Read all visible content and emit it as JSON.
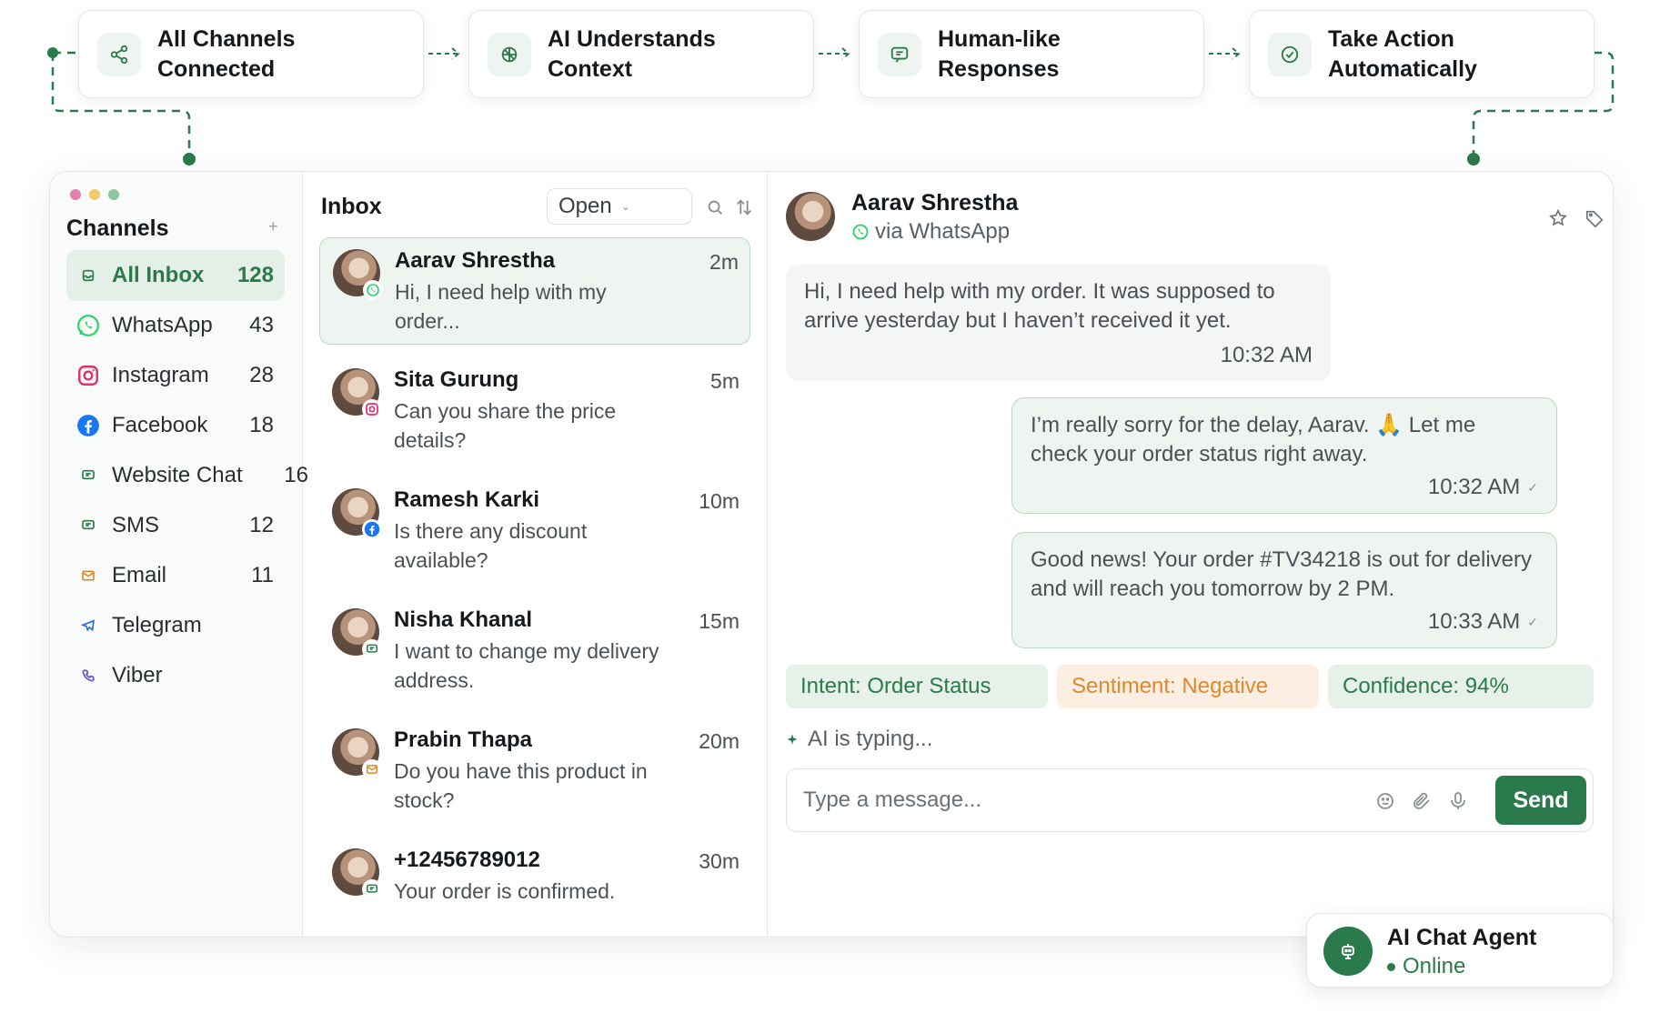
{
  "flow": {
    "steps": [
      {
        "label": "All Channels\nConnected",
        "icon": "share-icon"
      },
      {
        "label": "AI Understands\nContext",
        "icon": "brain-icon"
      },
      {
        "label": "Human-like\nResponses",
        "icon": "chat-bubble-icon"
      },
      {
        "label": "Take Action\nAutomatically",
        "icon": "check-circle-icon"
      }
    ]
  },
  "colors": {
    "brand": "#2b7a4b",
    "active_bg": "#e3efe7",
    "bubble_out": "#eef5f0",
    "sentiment_bg": "#fcefe2",
    "sentiment_text": "#e0892c",
    "window_dots": [
      "#e57fae",
      "#f0c76b",
      "#8cc79b"
    ]
  },
  "sidebar": {
    "title": "Channels",
    "add_label": "+",
    "items": [
      {
        "label": "All Inbox",
        "count": "128",
        "icon": "inbox-icon",
        "active": true
      },
      {
        "label": "WhatsApp",
        "count": "43",
        "icon": "whatsapp-icon"
      },
      {
        "label": "Instagram",
        "count": "28",
        "icon": "instagram-icon"
      },
      {
        "label": "Facebook",
        "count": "18",
        "icon": "facebook-icon"
      },
      {
        "label": "Website Chat",
        "count": "16",
        "icon": "website-chat-icon"
      },
      {
        "label": "SMS",
        "count": "12",
        "icon": "sms-icon"
      },
      {
        "label": "Email",
        "count": "11",
        "icon": "email-icon"
      },
      {
        "label": "Telegram",
        "count": "",
        "icon": "telegram-icon"
      },
      {
        "label": "Viber",
        "count": "",
        "icon": "viber-icon"
      }
    ]
  },
  "inbox": {
    "title": "Inbox",
    "filter": "Open",
    "conversations": [
      {
        "name": "Aarav Shrestha",
        "time": "2m",
        "message": "Hi, I need help with my order...",
        "channel": "whatsapp",
        "active": true
      },
      {
        "name": "Sita Gurung",
        "time": "5m",
        "message": "Can you share the price details?",
        "channel": "instagram"
      },
      {
        "name": "Ramesh Karki",
        "time": "10m",
        "message": "Is there any discount available?",
        "channel": "facebook"
      },
      {
        "name": "Nisha Khanal",
        "time": "15m",
        "message": "I want to change my delivery address.",
        "channel": "website-chat"
      },
      {
        "name": "Prabin Thapa",
        "time": "20m",
        "message": "Do you have this product in stock?",
        "channel": "email"
      },
      {
        "name": "+12456789012",
        "time": "30m",
        "message": "Your order is confirmed.",
        "channel": "sms"
      }
    ]
  },
  "chat": {
    "contact_name": "Aarav Shrestha",
    "via": "via WhatsApp",
    "messages": [
      {
        "direction": "in",
        "text": "Hi, I need help with my order. It was supposed to arrive yesterday but I haven’t received it yet.",
        "time": "10:32 AM"
      },
      {
        "direction": "out",
        "text": "I’m really sorry for the delay, Aarav. 🙏 Let me check your order status right away.",
        "time": "10:32 AM"
      },
      {
        "direction": "out",
        "text": "Good news! Your order #TV34218 is out for delivery and will reach you tomorrow by 2 PM.",
        "time": "10:33 AM"
      }
    ],
    "tags": {
      "intent": "Intent: Order Status",
      "sentiment": "Sentiment: Negative",
      "confidence": "Confidence: 94%"
    },
    "typing": "AI is typing...",
    "composer_placeholder": "Type a message...",
    "send_label": "Send"
  },
  "agent": {
    "name": "AI Chat Agent",
    "status": "Online"
  }
}
